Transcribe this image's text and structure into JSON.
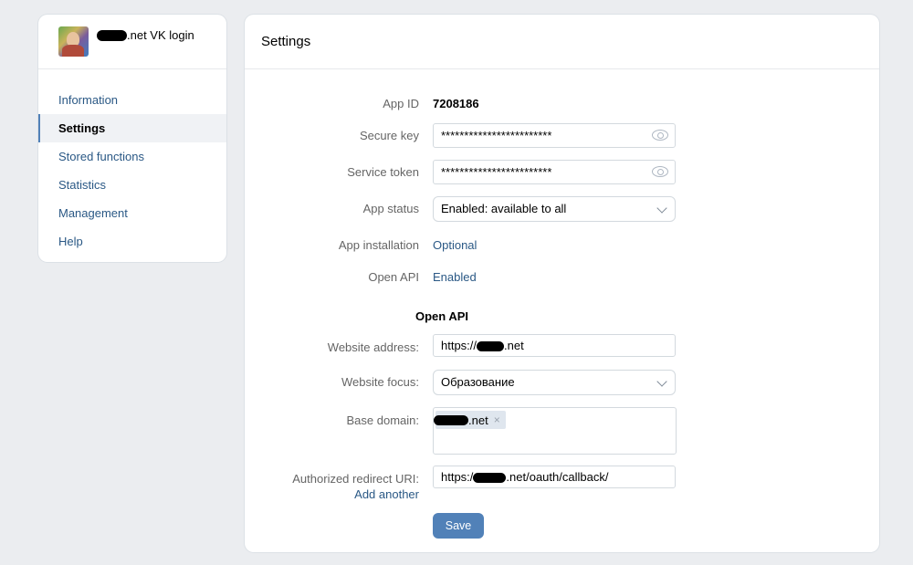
{
  "app": {
    "title_suffix": ".net VK login"
  },
  "sidebar": {
    "items": [
      {
        "label": "Information"
      },
      {
        "label": "Settings"
      },
      {
        "label": "Stored functions"
      },
      {
        "label": "Statistics"
      },
      {
        "label": "Management"
      },
      {
        "label": "Help"
      }
    ]
  },
  "panel": {
    "title": "Settings"
  },
  "form": {
    "app_id": {
      "label": "App ID",
      "value": "7208186"
    },
    "secure_key": {
      "label": "Secure key",
      "value": "************************"
    },
    "service_token": {
      "label": "Service token",
      "value": "************************"
    },
    "app_status": {
      "label": "App status",
      "value": "Enabled: available to all"
    },
    "app_installation": {
      "label": "App installation",
      "value": "Optional"
    },
    "open_api": {
      "label": "Open API",
      "value": "Enabled"
    },
    "open_api_section": {
      "title": "Open API"
    },
    "website_address": {
      "label": "Website address:",
      "prefix": "https://",
      "suffix": ".net"
    },
    "website_focus": {
      "label": "Website focus:",
      "value": "Образование"
    },
    "base_domain": {
      "label": "Base domain:",
      "chip_suffix": ".net",
      "chip_remove": "×"
    },
    "redirect_uri": {
      "label": "Authorized redirect URI:",
      "prefix": "https:/",
      "suffix": ".net/oauth/callback/",
      "add_another": "Add another"
    },
    "save_label": "Save"
  },
  "icons": {
    "eye": "eye-icon",
    "chevron": "chevron-down-icon",
    "remove": "close-icon"
  },
  "colors": {
    "accent": "#5181b8",
    "link": "#2a5885",
    "background": "#ebedf0"
  }
}
